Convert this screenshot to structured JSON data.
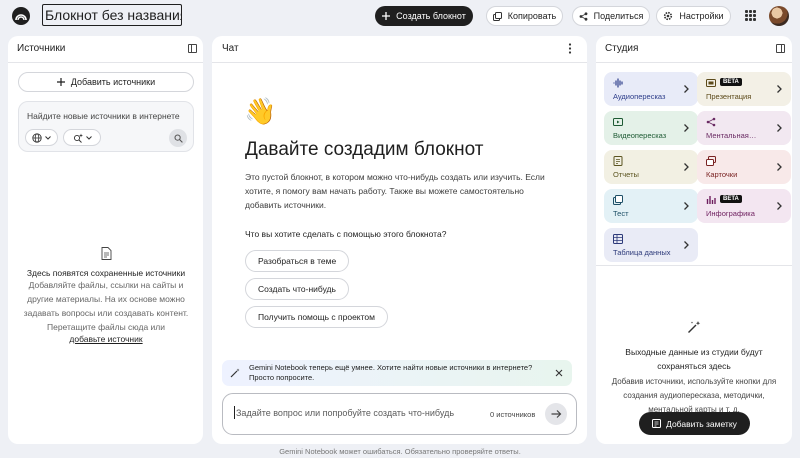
{
  "header": {
    "notebook_title": "Блокнот без названия",
    "create_label": "Создать блокнот",
    "copy_label": "Копировать",
    "share_label": "Поделиться",
    "settings_label": "Настройки"
  },
  "sources": {
    "title": "Источники",
    "add_label": "Добавить источники",
    "search_placeholder": "Найдите новые источники в интернете",
    "empty_title": "Здесь появятся сохраненные источники",
    "empty_lines": [
      "Добавляйте файлы, ссылки на сайты и",
      "другие материалы. На их основе можно",
      "задавать вопросы или создавать контент.",
      "Перетащите файлы сюда или"
    ],
    "add_link": "добавьте источник"
  },
  "chat": {
    "title": "Чат",
    "emoji": "👋",
    "heading": "Давайте создадим блокнот",
    "intro": "Это пустой блокнот, в котором можно что-нибудь создать или изучить. Если хотите, я помогу вам начать работу. Также вы можете самостоятельно добавить источники.",
    "question": "Что вы хотите сделать с помощью этого блокнота?",
    "suggestions": [
      "Разобраться в теме",
      "Создать что-нибудь",
      "Получить помощь с проектом"
    ],
    "banner_text": "Gemini Notebook теперь ещё умнее. Хотите найти новые источники в интернете? Просто попросите.",
    "input_placeholder": "Задайте вопрос или попробуйте создать что-нибудь",
    "sources_count": "0 источников"
  },
  "studio": {
    "title": "Студия",
    "tiles": [
      {
        "label": "Аудиопересказ",
        "bg": "#e8ebf8",
        "color": "#2d3d8a",
        "icon": "waveform-icon",
        "beta": ""
      },
      {
        "label": "Презентация",
        "bg": "#f3f0e6",
        "color": "#5c4a1a",
        "icon": "slides-icon",
        "beta": "BETA"
      },
      {
        "label": "Видеопересказ",
        "bg": "#e4f1e8",
        "color": "#1d5a33",
        "icon": "video-icon",
        "beta": ""
      },
      {
        "label": "Ментальная…",
        "bg": "#f2e8f1",
        "color": "#6a2b63",
        "icon": "mindmap-icon",
        "beta": ""
      },
      {
        "label": "Отчеты",
        "bg": "#f2f0e3",
        "color": "#5b5420",
        "icon": "report-icon",
        "beta": ""
      },
      {
        "label": "Карточки",
        "bg": "#f8e9e9",
        "color": "#7a2323",
        "icon": "cards-icon",
        "beta": ""
      },
      {
        "label": "Тест",
        "bg": "#e3f1f6",
        "color": "#1d4f66",
        "icon": "quiz-icon",
        "beta": ""
      },
      {
        "label": "Инфографика",
        "bg": "#f3e6f1",
        "color": "#6e1f5f",
        "icon": "infographic-icon",
        "beta": "BETA"
      },
      {
        "label": "Таблица данных",
        "bg": "#e9ebf6",
        "color": "#2d3a7a",
        "icon": "table-icon",
        "beta": ""
      }
    ],
    "empty_title": "Выходные данные из студии будут сохраняться здесь",
    "empty_text": "Добавив источники, используйте кнопки для создания аудиопересказа, методички, ментальной карты и т. д.",
    "add_note_label": "Добавить заметку"
  },
  "footer": {
    "text": "Gemini Notebook может ошибаться. Обязательно проверяйте ответы."
  }
}
